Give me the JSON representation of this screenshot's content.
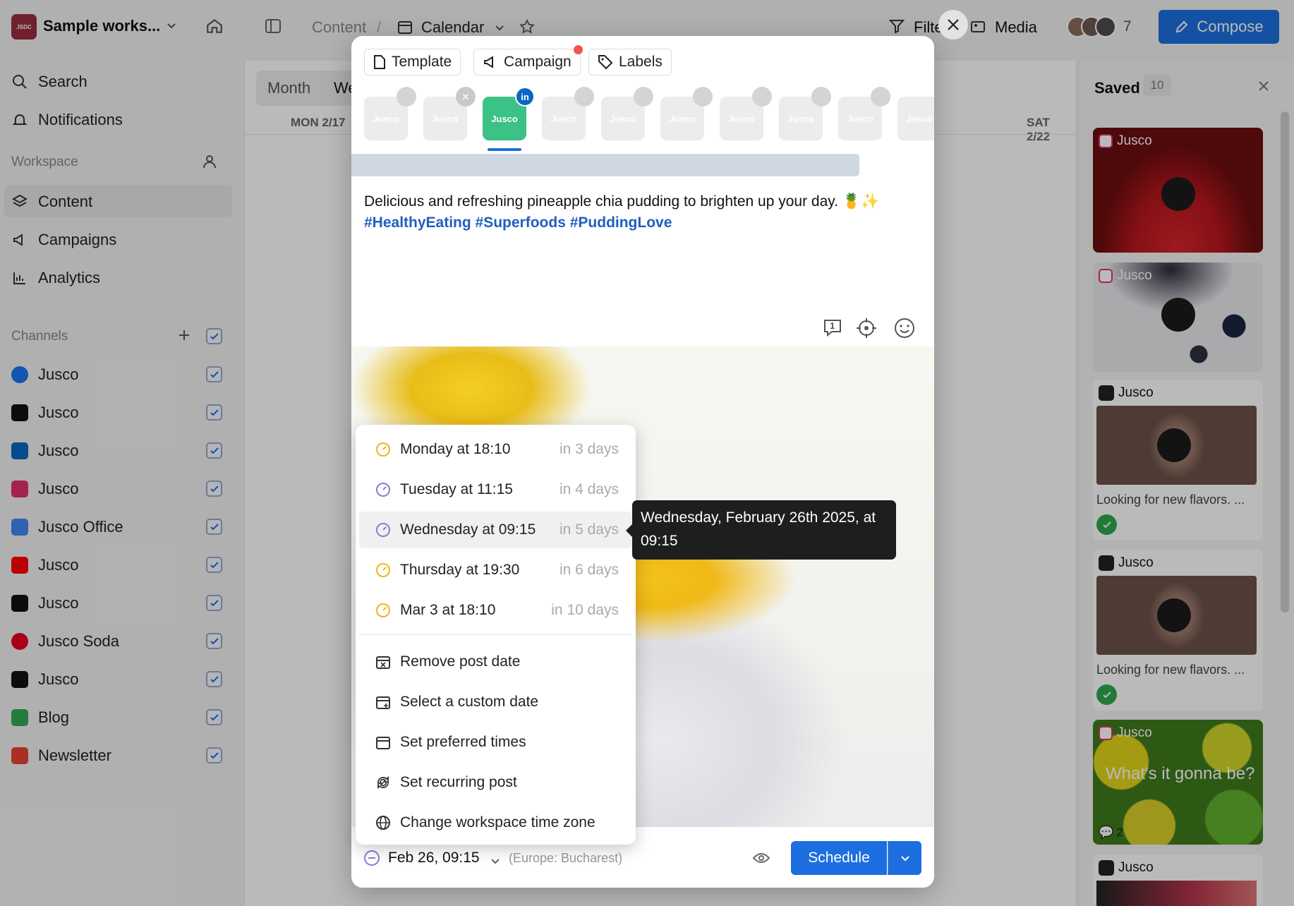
{
  "workspace": {
    "logo_text": "JSDC",
    "name": "Sample works..."
  },
  "breadcrumb": {
    "content": "Content",
    "separator": "/",
    "calendar": "Calendar"
  },
  "header": {
    "filter": "Filter",
    "media": "Media",
    "members_count": "7",
    "compose": "Compose"
  },
  "sidebar": {
    "search": "Search",
    "notifications": "Notifications",
    "workspace_label": "Workspace",
    "nav": [
      {
        "label": "Content"
      },
      {
        "label": "Campaigns"
      },
      {
        "label": "Analytics"
      }
    ],
    "channels_label": "Channels",
    "channels": [
      {
        "label": "Jusco",
        "icon": "facebook-icon",
        "color": "#1877f2"
      },
      {
        "label": "Jusco",
        "icon": "x-icon",
        "color": "#111111"
      },
      {
        "label": "Jusco",
        "icon": "linkedin-icon",
        "color": "#0a66c2"
      },
      {
        "label": "Jusco",
        "icon": "instagram-icon",
        "color": "#e1306c"
      },
      {
        "label": "Jusco Office",
        "icon": "google-business-icon",
        "color": "#4285f4"
      },
      {
        "label": "Jusco",
        "icon": "youtube-icon",
        "color": "#ff0000"
      },
      {
        "label": "Jusco",
        "icon": "tiktok-icon",
        "color": "#111111"
      },
      {
        "label": "Jusco Soda",
        "icon": "pinterest-icon",
        "color": "#e60023"
      },
      {
        "label": "Jusco",
        "icon": "threads-icon",
        "color": "#111111"
      },
      {
        "label": "Blog",
        "icon": "blog-icon",
        "color": "#34a853"
      },
      {
        "label": "Newsletter",
        "icon": "newsletter-icon",
        "color": "#ea4335"
      }
    ]
  },
  "calendar": {
    "view_tabs": [
      "Month",
      "We"
    ],
    "day_mon": "MON 2/17",
    "day_sat": "SAT 2/22"
  },
  "saved": {
    "title": "Saved",
    "count": "10",
    "cards": [
      {
        "channel": "Jusco",
        "icon": "instagram-icon"
      },
      {
        "channel": "Jusco",
        "icon": "instagram-icon"
      },
      {
        "channel": "Jusco",
        "icon": "threads-icon",
        "caption": "Looking for new flavors. ..."
      },
      {
        "channel": "Jusco",
        "icon": "tiktok-icon",
        "caption": "Looking for new flavors. ..."
      },
      {
        "channel": "Jusco",
        "icon": "instagram-icon",
        "overlay_text": "What's it gonna be?",
        "comments": "2"
      },
      {
        "channel": "Jusco",
        "icon": "threads-icon"
      }
    ]
  },
  "composer": {
    "chips": {
      "template": "Template",
      "campaign": "Campaign",
      "labels": "Labels"
    },
    "channel_avatar_text": "Jusco",
    "post_text": "Delicious and refreshing pineapple chia pudding to brighten up your day. 🍍✨",
    "hashtags": "#HealthyEating #Superfoods #PuddingLove",
    "comment_count": "1",
    "footer": {
      "date": "Feb 26, 09:15",
      "timezone": "(Europe: Bucharest)",
      "schedule": "Schedule"
    }
  },
  "date_menu": {
    "suggestions": [
      {
        "label": "Monday at 18:10",
        "relative": "in 3 days",
        "icon_color": "#f1b51c"
      },
      {
        "label": "Tuesday at 11:15",
        "relative": "in 4 days",
        "icon_color": "#8b7bd8"
      },
      {
        "label": "Wednesday at 09:15",
        "relative": "in 5 days",
        "icon_color": "#8b7bd8"
      },
      {
        "label": "Thursday at 19:30",
        "relative": "in 6 days",
        "icon_color": "#f1b51c"
      },
      {
        "label": "Mar 3 at 18:10",
        "relative": "in 10 days",
        "icon_color": "#f1b51c"
      }
    ],
    "actions": [
      {
        "label": "Remove post date"
      },
      {
        "label": "Select a custom date"
      },
      {
        "label": "Set preferred times"
      },
      {
        "label": "Set recurring post"
      },
      {
        "label": "Change workspace time zone"
      }
    ]
  },
  "tooltip": {
    "text": "Wednesday, February 26th 2025, at 09:15"
  }
}
